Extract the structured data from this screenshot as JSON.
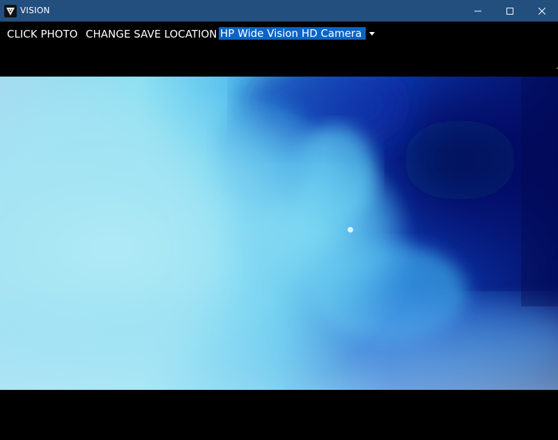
{
  "window": {
    "title": "VISION",
    "titlebar_color": "#234f7e"
  },
  "titlebar_controls": {
    "minimize_icon": "minimize-icon",
    "maximize_icon": "maximize-icon",
    "close_icon": "close-icon"
  },
  "toolbar": {
    "click_photo_label": "CLICK PHOTO",
    "change_save_location_label": "CHANGE SAVE LOCATION",
    "camera_select": {
      "selected": "HP Wide Vision HD Camera",
      "highlight_color": "#0a64c8"
    }
  },
  "preview": {
    "content": "live camera feed"
  }
}
